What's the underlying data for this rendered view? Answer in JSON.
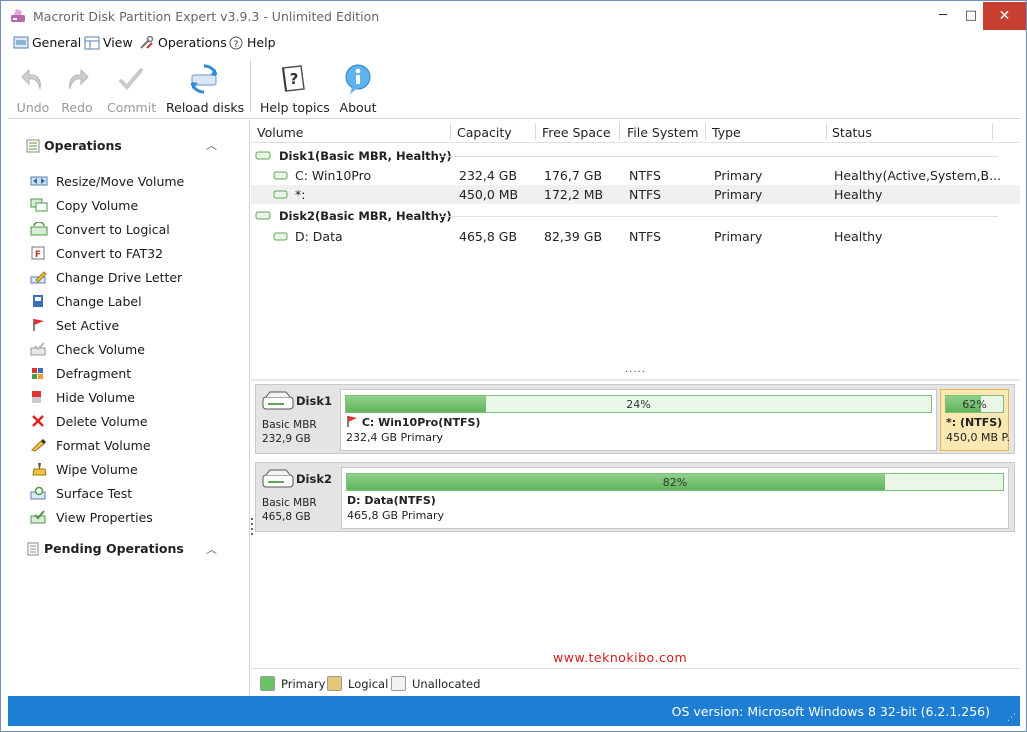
{
  "window": {
    "title": "Macrorit Disk Partition Expert v3.9.3 - Unlimited Edition",
    "minimize": "─",
    "maximize": "□",
    "close": "✕"
  },
  "menu": [
    {
      "label": "General",
      "icon": "general-icon"
    },
    {
      "label": "View",
      "icon": "view-icon"
    },
    {
      "label": "Operations",
      "icon": "operations-icon"
    },
    {
      "label": "Help",
      "icon": "help-icon"
    }
  ],
  "toolbar": {
    "undo": "Undo",
    "redo": "Redo",
    "commit": "Commit",
    "reload": "Reload disks",
    "help_topics": "Help topics",
    "about": "About"
  },
  "left_panel": {
    "operations_title": "Operations",
    "operations": [
      {
        "label": "Resize/Move Volume",
        "icon": "resize-icon"
      },
      {
        "label": "Copy Volume",
        "icon": "copy-icon"
      },
      {
        "label": "Convert to Logical",
        "icon": "convert-logical-icon"
      },
      {
        "label": "Convert to FAT32",
        "icon": "convert-fat32-icon"
      },
      {
        "label": "Change Drive Letter",
        "icon": "drive-letter-icon"
      },
      {
        "label": "Change Label",
        "icon": "label-icon"
      },
      {
        "label": "Set Active",
        "icon": "flag-icon"
      },
      {
        "label": "Check Volume",
        "icon": "check-icon"
      },
      {
        "label": "Defragment",
        "icon": "defragment-icon"
      },
      {
        "label": "Hide Volume",
        "icon": "hide-icon"
      },
      {
        "label": "Delete Volume",
        "icon": "delete-icon"
      },
      {
        "label": "Format Volume",
        "icon": "format-icon"
      },
      {
        "label": "Wipe Volume",
        "icon": "wipe-icon"
      },
      {
        "label": "Surface Test",
        "icon": "surface-test-icon"
      },
      {
        "label": "View Properties",
        "icon": "properties-icon"
      }
    ],
    "pending_title": "Pending Operations"
  },
  "table": {
    "columns": [
      "Volume",
      "Capacity",
      "Free Space",
      "File System",
      "Type",
      "Status"
    ],
    "disk1": {
      "label": "Disk1(Basic MBR, Healthy)",
      "rows": [
        {
          "volume": "C: Win10Pro",
          "capacity": "232,4 GB",
          "free": "176,7 GB",
          "fs": "NTFS",
          "type": "Primary",
          "status": "Healthy(Active,System,B..."
        },
        {
          "volume": "*:",
          "capacity": "450,0 MB",
          "free": "172,2 MB",
          "fs": "NTFS",
          "type": "Primary",
          "status": "Healthy"
        }
      ]
    },
    "disk2": {
      "label": "Disk2(Basic MBR, Healthy)",
      "rows": [
        {
          "volume": "D: Data",
          "capacity": "465,8 GB",
          "free": "82,39 GB",
          "fs": "NTFS",
          "type": "Primary",
          "status": "Healthy"
        }
      ]
    },
    "splitter": "....."
  },
  "diskmap": {
    "disk1": {
      "name": "Disk1",
      "type": "Basic MBR",
      "size": "232,9 GB",
      "partitions": [
        {
          "name": "C: Win10Pro(NTFS)",
          "info": "232,4 GB Primary",
          "used_pct": 24,
          "pct_label": "24%"
        },
        {
          "name": "*: (NTFS)",
          "info": "450,0 MB P.",
          "used_pct": 62,
          "pct_label": "62%"
        }
      ]
    },
    "disk2": {
      "name": "Disk2",
      "type": "Basic MBR",
      "size": "465,8 GB",
      "partitions": [
        {
          "name": "D: Data(NTFS)",
          "info": "465,8 GB Primary",
          "used_pct": 82,
          "pct_label": "82%"
        }
      ]
    }
  },
  "watermark": "www.teknokibo.com",
  "legend": {
    "primary": "Primary",
    "logical": "Logical",
    "unallocated": "Unallocated",
    "colors": {
      "primary": "#6cc066",
      "logical": "#e5c77a",
      "unallocated": "#f2f2f2"
    }
  },
  "status": {
    "os": "OS version: Microsoft Windows 8  32-bit  (6.2.1.256)"
  }
}
